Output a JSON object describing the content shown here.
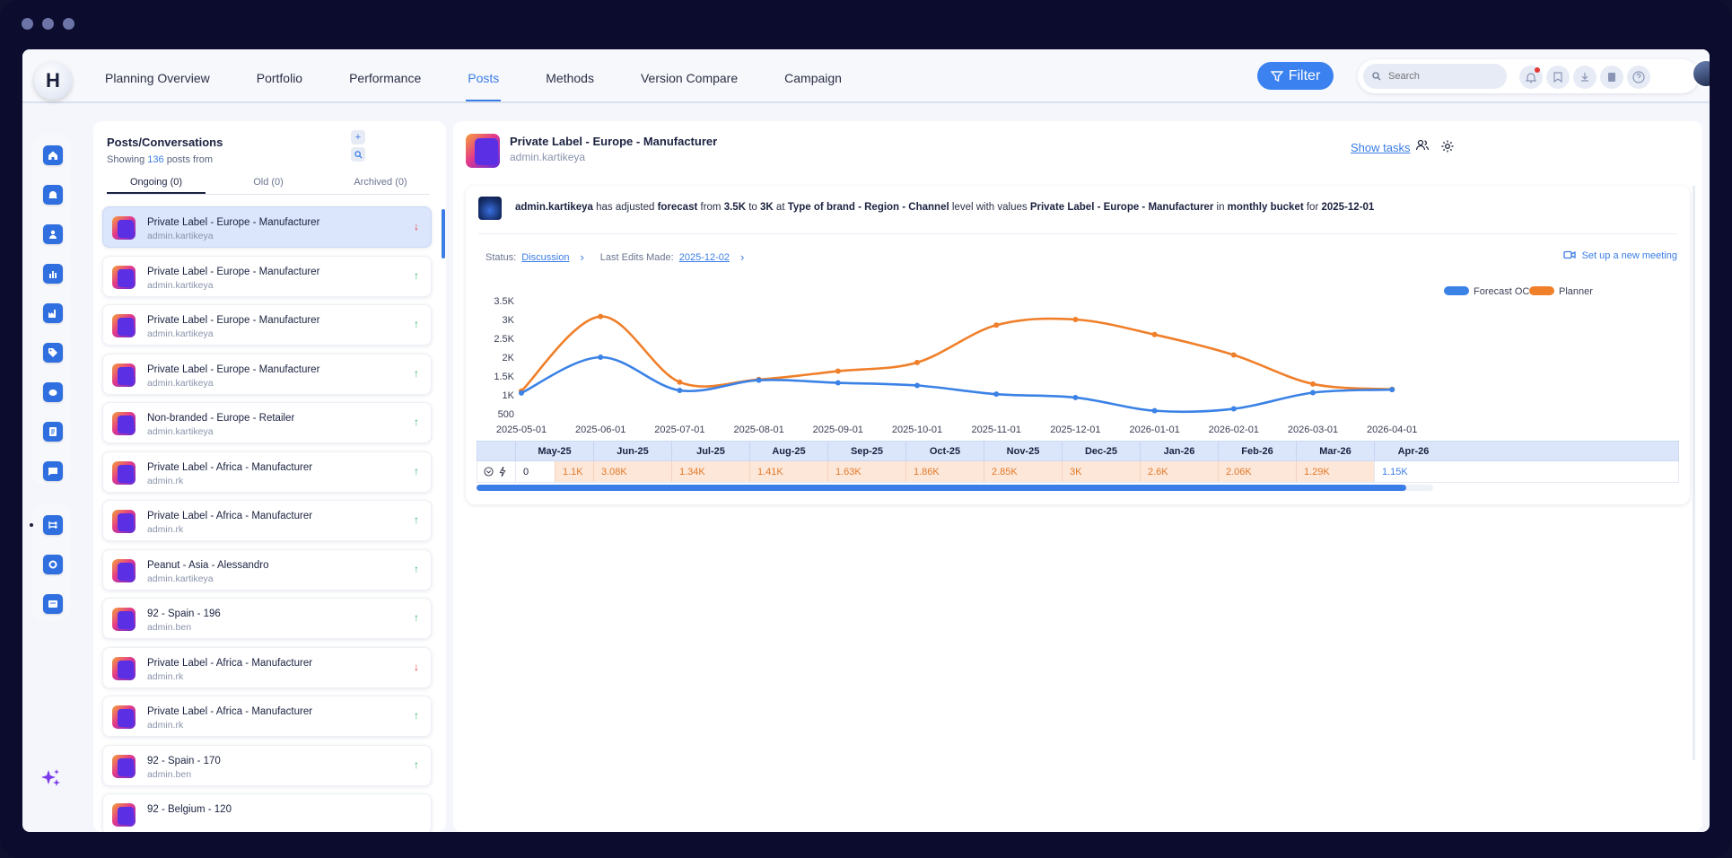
{
  "nav": {
    "items": [
      "Planning Overview",
      "Portfolio",
      "Performance",
      "Posts",
      "Methods",
      "Version Compare",
      "Campaign"
    ],
    "active": "Posts",
    "filter_label": "Filter",
    "search_placeholder": "Search",
    "logo_letter": "H"
  },
  "posts": {
    "title": "Posts/Conversations",
    "showing_prefix": "Showing",
    "showing_count": "136",
    "showing_suffix": "posts from",
    "tabs": [
      "Ongoing (0)",
      "Old (0)",
      "Archived (0)"
    ],
    "items": [
      {
        "name": "Private Label - Europe - Manufacturer",
        "user": "admin.kartikeya",
        "trend": "down"
      },
      {
        "name": "Private Label - Europe - Manufacturer",
        "user": "admin.kartikeya",
        "trend": "up"
      },
      {
        "name": "Private Label - Europe - Manufacturer",
        "user": "admin.kartikeya",
        "trend": "up"
      },
      {
        "name": "Private Label - Europe - Manufacturer",
        "user": "admin.kartikeya",
        "trend": "up"
      },
      {
        "name": "Non-branded - Europe - Retailer",
        "user": "admin.kartikeya",
        "trend": "up"
      },
      {
        "name": "Private Label - Africa - Manufacturer",
        "user": "admin.rk",
        "trend": "up"
      },
      {
        "name": "Private Label - Africa - Manufacturer",
        "user": "admin.rk",
        "trend": "up"
      },
      {
        "name": "Peanut - Asia - Alessandro",
        "user": "admin.kartikeya",
        "trend": "up"
      },
      {
        "name": "92 - Spain - 196",
        "user": "admin.ben",
        "trend": "up"
      },
      {
        "name": "Private Label - Africa - Manufacturer",
        "user": "admin.rk",
        "trend": "down"
      },
      {
        "name": "Private Label - Africa - Manufacturer",
        "user": "admin.rk",
        "trend": "up"
      },
      {
        "name": "92 - Spain - 170",
        "user": "admin.ben",
        "trend": "up"
      },
      {
        "name": "92 - Belgium - 120",
        "user": "",
        "trend": ""
      }
    ]
  },
  "detail": {
    "title": "Private Label - Europe - Manufacturer",
    "user": "admin.kartikeya",
    "show_tasks": "Show tasks",
    "message": {
      "user": "admin.kartikeya",
      "t1": "has adjusted",
      "metric": "forecast",
      "t2": "from",
      "from": "3.5K",
      "t3": "to",
      "to": "3K",
      "t4": "at",
      "level": "Type of brand - Region - Channel",
      "t5": "level with values",
      "values": "Private Label - Europe - Manufacturer",
      "t6": "in",
      "bucket": "monthly bucket",
      "t7": "for",
      "date": "2025-12-01"
    },
    "status_label": "Status:",
    "status_value": "Discussion",
    "last_edits_label": "Last Edits Made:",
    "last_edits_value": "2025-12-02",
    "meeting": "Set up a new meeting"
  },
  "chart_data": {
    "type": "line",
    "x": [
      "2025-05-01",
      "2025-06-01",
      "2025-07-01",
      "2025-08-01",
      "2025-09-01",
      "2025-10-01",
      "2025-11-01",
      "2025-12-01",
      "2026-01-01",
      "2026-02-01",
      "2026-03-01",
      "2026-04-01"
    ],
    "yticks": [
      "3.5K",
      "3K",
      "2.5K",
      "2K",
      "1.5K",
      "1K",
      "500"
    ],
    "ylim": [
      500,
      3500
    ],
    "legend_position": "top-right",
    "series": [
      {
        "name": "Forecast OC",
        "color": "#3b82e6",
        "values": [
          1050,
          2000,
          1120,
          1390,
          1320,
          1250,
          1020,
          930,
          580,
          630,
          1060,
          1140
        ]
      },
      {
        "name": "Planner",
        "color": "#f07f2a",
        "values": [
          1100,
          3080,
          1340,
          1410,
          1630,
          1860,
          2850,
          3000,
          2600,
          2060,
          1290,
          1150
        ]
      }
    ]
  },
  "table": {
    "months": [
      "May-25",
      "Jun-25",
      "Jul-25",
      "Aug-25",
      "Sep-25",
      "Oct-25",
      "Nov-25",
      "Dec-25",
      "Jan-26",
      "Feb-26",
      "Mar-26",
      "Apr-26"
    ],
    "row_first": "0",
    "values": [
      "1.1K",
      "3.08K",
      "1.34K",
      "1.41K",
      "1.63K",
      "1.86K",
      "2.85K",
      "3K",
      "2.6K",
      "2.06K",
      "1.29K",
      "1.15K"
    ]
  }
}
